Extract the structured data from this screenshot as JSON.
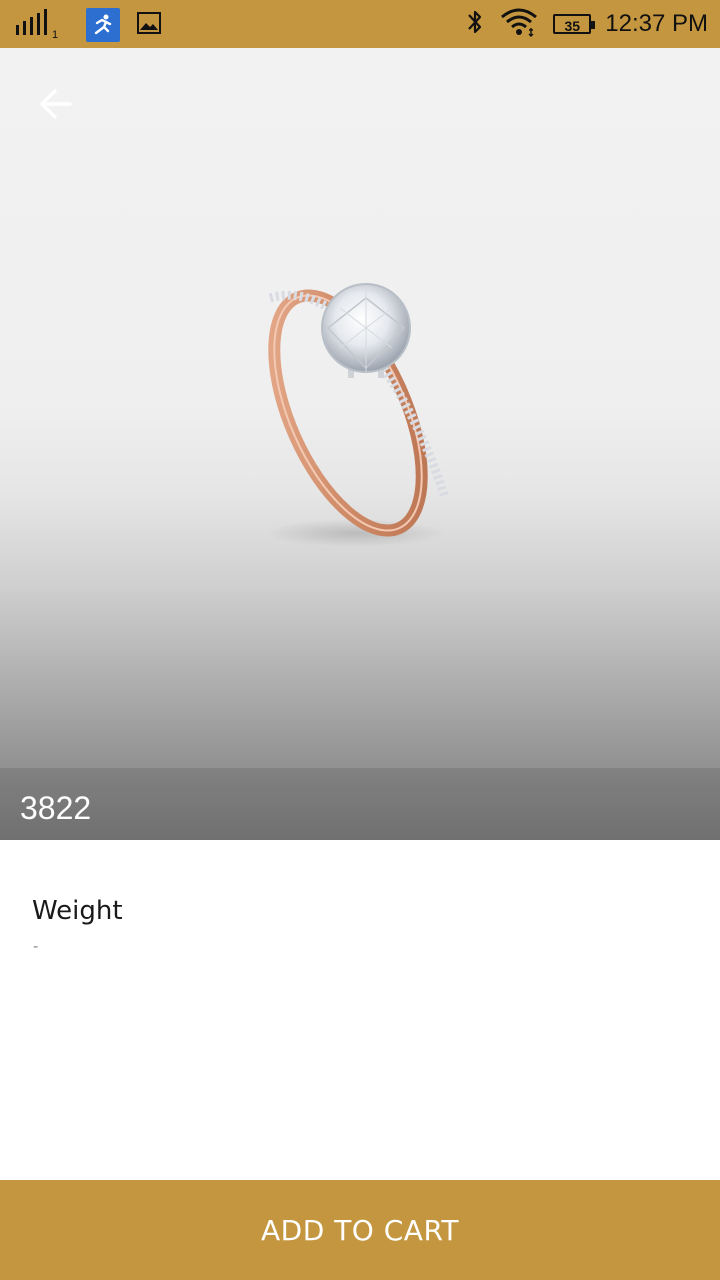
{
  "status_bar": {
    "sim_number": "1",
    "battery_level": "35",
    "time": "12:37 PM"
  },
  "product": {
    "code": "3822",
    "weight_label": "Weight",
    "weight_value": "-"
  },
  "actions": {
    "add_to_cart_label": "ADD TO CART"
  },
  "colors": {
    "accent": "#c4963f"
  }
}
